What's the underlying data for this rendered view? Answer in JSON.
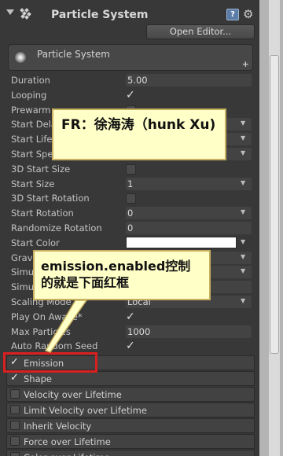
{
  "component": {
    "title": "Particle System",
    "open_editor_label": "Open Editor...",
    "help_icon": "?",
    "icons": [
      "fold-arrow-icon",
      "particle-system-icon",
      "help-icon",
      "gear-icon"
    ]
  },
  "system": {
    "label": "Particle System",
    "plus": "+"
  },
  "properties": [
    {
      "label": "Duration",
      "kind": "field",
      "value": "5.00"
    },
    {
      "label": "Looping",
      "kind": "check",
      "checked": true
    },
    {
      "label": "Prewarm",
      "kind": "check",
      "checked": false
    },
    {
      "label": "Start Delay",
      "kind": "field",
      "value": "",
      "dropdown": true
    },
    {
      "label": "Start Lifetime",
      "kind": "field",
      "value": "",
      "dropdown": true
    },
    {
      "label": "Start Speed",
      "kind": "field",
      "value": "",
      "dropdown": true
    },
    {
      "label": "3D Start Size",
      "kind": "check",
      "checked": false
    },
    {
      "label": "Start Size",
      "kind": "field",
      "value": "1",
      "dropdown": true
    },
    {
      "label": "3D Start Rotation",
      "kind": "check",
      "checked": false
    },
    {
      "label": "Start Rotation",
      "kind": "field",
      "value": "0",
      "dropdown": true
    },
    {
      "label": "Randomize Rotation",
      "kind": "field",
      "value": "0"
    },
    {
      "label": "Start Color",
      "kind": "color",
      "dropdown": true
    },
    {
      "label": "Gravity Modifier",
      "kind": "field",
      "value": "",
      "dropdown": true
    },
    {
      "label": "Simulation Space",
      "kind": "field",
      "value": "",
      "dropdown": true
    },
    {
      "label": "Simulation Speed",
      "kind": "field",
      "value": ""
    },
    {
      "label": "Scaling Mode",
      "kind": "field",
      "value": "Local",
      "dropdown": true
    },
    {
      "label": "Play On Awake*",
      "kind": "check",
      "checked": true
    },
    {
      "label": "Max Particles",
      "kind": "field",
      "value": "1000"
    },
    {
      "label": "Auto Random Seed",
      "kind": "check",
      "checked": true
    }
  ],
  "modules": [
    {
      "label": "Emission",
      "checked": true
    },
    {
      "label": "Shape",
      "checked": true
    },
    {
      "label": "Velocity over Lifetime",
      "checked": false
    },
    {
      "label": "Limit Velocity over Lifetime",
      "checked": false
    },
    {
      "label": "Inherit Velocity",
      "checked": false
    },
    {
      "label": "Force over Lifetime",
      "checked": false
    },
    {
      "label": "Color over Lifetime",
      "checked": false
    }
  ],
  "annotations": {
    "fr_note": "FR：徐海涛（hunk Xu)",
    "emission_note": "emission.enabled控制的就是下面红框",
    "highlight_color": "#d92020",
    "note_background": "#ffffc8"
  },
  "checkmark": "✓"
}
